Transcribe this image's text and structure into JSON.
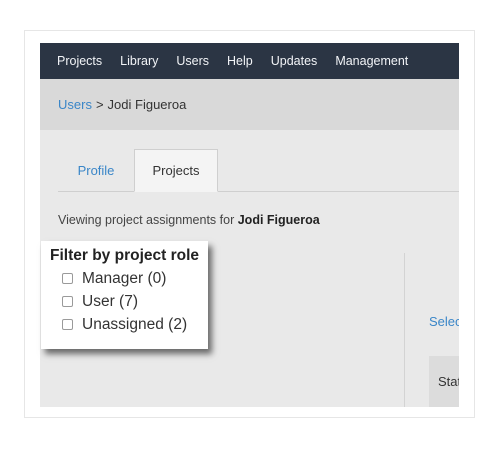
{
  "nav": {
    "items": [
      "Projects",
      "Library",
      "Users",
      "Help",
      "Updates",
      "Management"
    ]
  },
  "breadcrumb": {
    "parent": "Users",
    "separator": ">",
    "current": "Jodi Figueroa"
  },
  "tabs": [
    {
      "label": "Profile",
      "active": false
    },
    {
      "label": "Projects",
      "active": true
    }
  ],
  "viewing": {
    "prefix": "Viewing project assignments for",
    "name": "Jodi Figueroa"
  },
  "filter": {
    "title": "Filter by project role",
    "options": [
      {
        "label": "Manager (0)",
        "checked": false
      },
      {
        "label": "User (7)",
        "checked": false
      },
      {
        "label": "Unassigned (2)",
        "checked": false
      }
    ]
  },
  "right_panel": {
    "select_link": "Selec",
    "status_header": "Stat"
  },
  "colors": {
    "navbar": "#2b3544",
    "link": "#3a86c8",
    "breadcrumb_bg": "#d9d9d9"
  }
}
